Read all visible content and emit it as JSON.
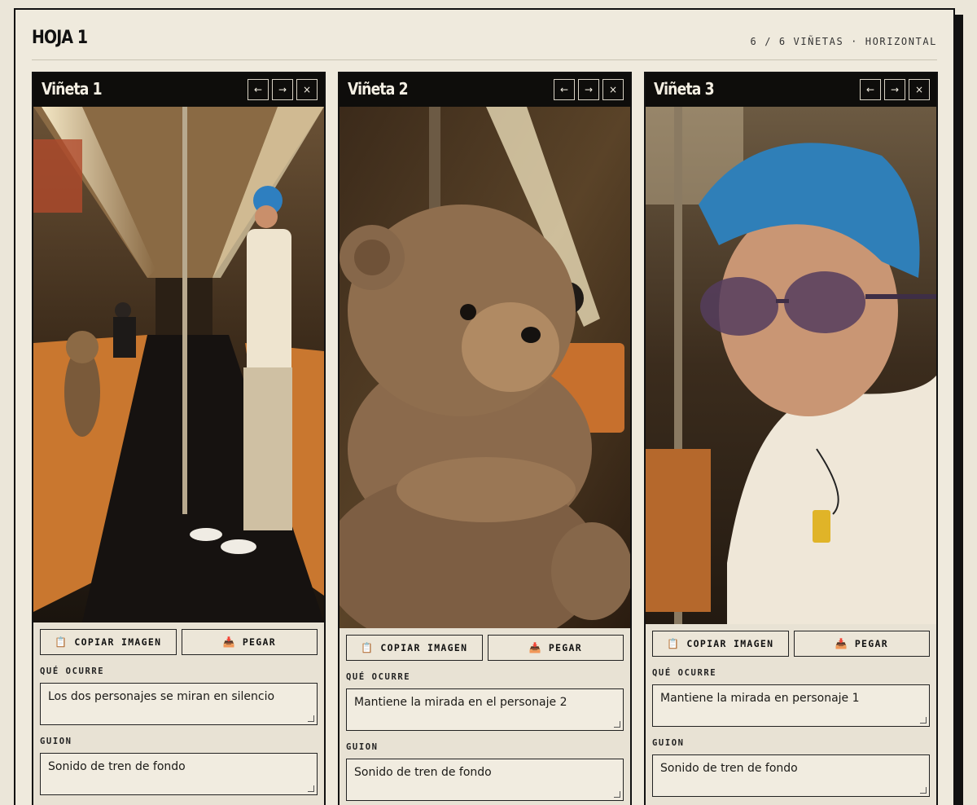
{
  "sheet": {
    "title": "HOJA 1",
    "meta": "6 / 6 VIÑETAS · HORIZONTAL"
  },
  "icons": {
    "prev": "←",
    "next": "→",
    "close": "×",
    "copy": "clipboard-icon",
    "paste": "paste-icon"
  },
  "labels": {
    "copy_image": "COPIAR IMAGEN",
    "paste": "PEGAR",
    "what_happens": "QUÉ OCURRE",
    "script": "GUION"
  },
  "panels": [
    {
      "title": "Viñeta 1",
      "image_desc": "subway",
      "what_happens": "Los dos personajes se miran en silencio",
      "script": "Sonido de tren de fondo"
    },
    {
      "title": "Viñeta 2",
      "image_desc": "teddy bear",
      "what_happens": "Mantiene la mirada en el personaje 2",
      "script": "Sonido de tren de fondo"
    },
    {
      "title": "Viñeta 3",
      "image_desc": "man",
      "what_happens": "Mantiene la mirada en personaje 1",
      "script": "Sonido de tren de fondo"
    }
  ]
}
